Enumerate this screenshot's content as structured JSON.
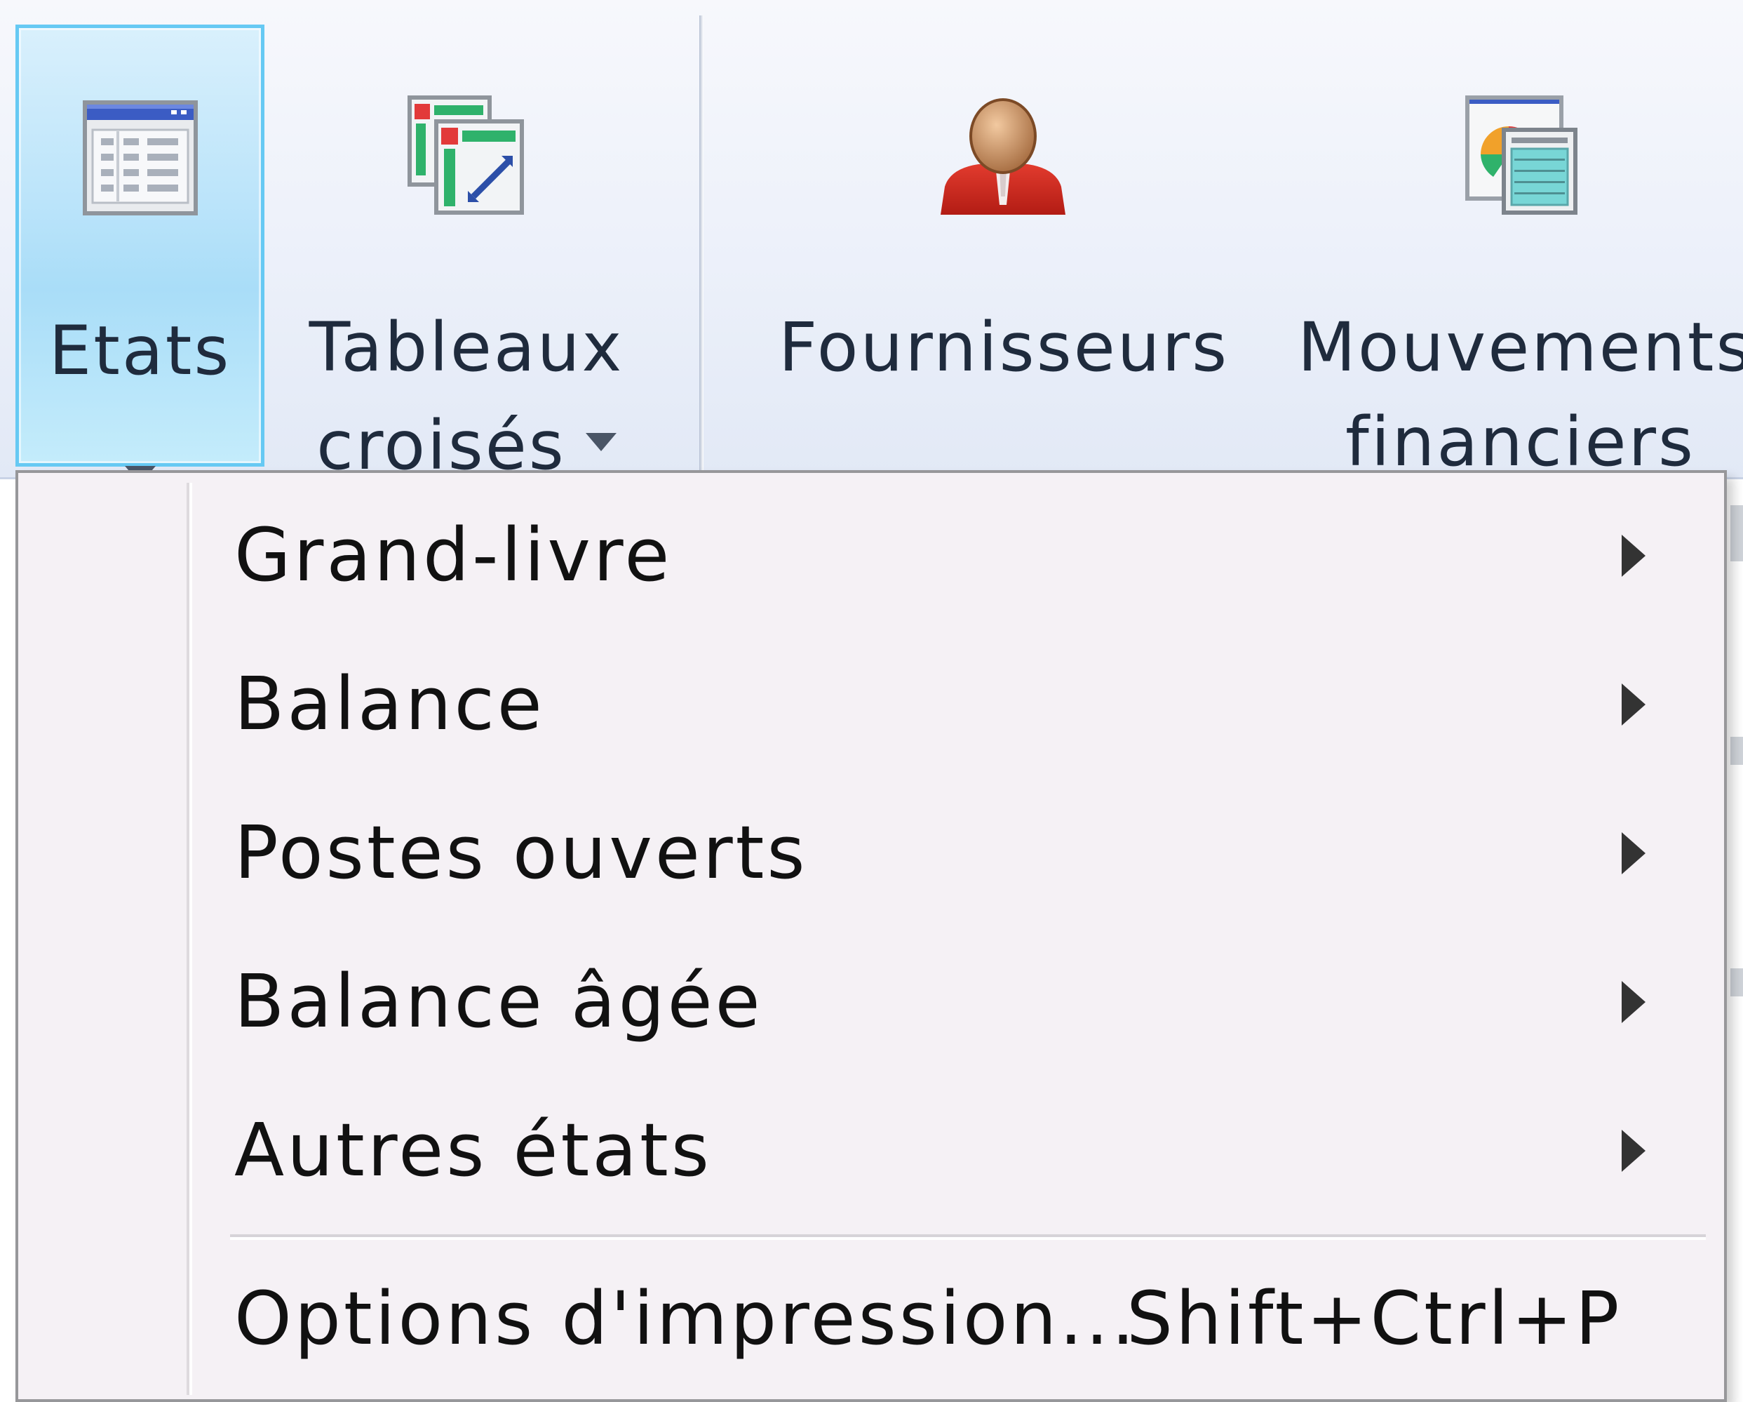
{
  "ribbon": {
    "buttons": [
      {
        "line1": "Etats",
        "line2": "",
        "has_dropdown": true,
        "active": true,
        "icon": "report-grid-icon"
      },
      {
        "line1": "Tableaux",
        "line2": "croisés",
        "has_dropdown": true,
        "active": false,
        "icon": "pivot-table-icon"
      },
      {
        "line1": "Fournisseurs",
        "line2": "",
        "has_dropdown": false,
        "active": false,
        "icon": "supplier-person-icon"
      },
      {
        "line1": "Mouvements",
        "line2": "financiers",
        "has_dropdown": false,
        "active": false,
        "icon": "financial-movements-icon"
      }
    ]
  },
  "menu": {
    "items": [
      {
        "label": "Grand-livre",
        "has_submenu": true
      },
      {
        "label": "Balance",
        "has_submenu": true
      },
      {
        "label": "Postes ouverts",
        "has_submenu": true
      },
      {
        "label": "Balance âgée",
        "has_submenu": true
      },
      {
        "label": "Autres états",
        "has_submenu": true
      }
    ],
    "options": {
      "label": "Options d'impression...",
      "shortcut": "Shift+Ctrl+P"
    }
  },
  "colors": {
    "active_border": "#66c9f3",
    "active_fill": "#bbe4fa",
    "menu_background": "#f5f1f5",
    "menu_border": "#97979a"
  }
}
